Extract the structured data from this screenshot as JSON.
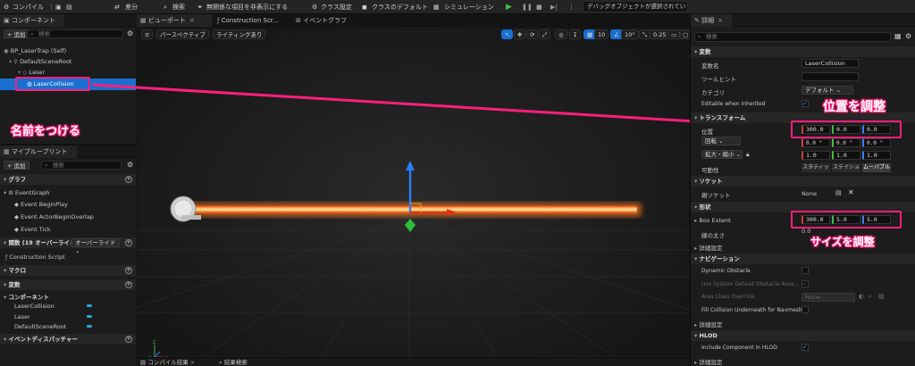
{
  "toolbar": {
    "compile": "コンパイル",
    "diff": "差分",
    "search": "検索",
    "hide_unrelated": "無関係な項目を非表示にする",
    "class_settings": "クラス設定",
    "class_defaults": "クラスのデフォルト",
    "simulation": "シミュレーション",
    "debug_object": "デバッグオブジェクトが選択されていません"
  },
  "components_panel": {
    "title": "コンポーネント",
    "add": "+ 追加",
    "search_placeholder": "検索",
    "tree": [
      "BP_LaserTrap (Self)",
      "DefaultSceneRoot",
      "Laser",
      "LaserCollision"
    ]
  },
  "blueprint_panel": {
    "title": "マイブループリント",
    "add": "+ 追加",
    "search_placeholder": "検索",
    "graph_section": "グラフ",
    "event_graph": "EventGraph",
    "events": [
      "Event BeginPlay",
      "Event ActorBeginOverlap",
      "Event Tick"
    ],
    "functions_section": "関数 (19 オーバーライド可",
    "override_dropdown": "オーバーライド",
    "construction_script": "Construction Script",
    "macro_section": "マクロ",
    "variables_section": "変数",
    "components_subsection": "コンポーネント",
    "component_vars": [
      "LaserCollision",
      "Laser",
      "DefaultSceneRoot"
    ],
    "dispatchers_section": "イベントディスパッチャー"
  },
  "viewport": {
    "tabs": [
      "ビューポート",
      "Construction Scr...",
      "イベントグラフ"
    ],
    "perspective": "パースペクティブ",
    "lighting": "ライティングあり",
    "grid_snap": "10",
    "rot_snap": "10°",
    "scale_snap": "0.25",
    "cam_speed": "1",
    "bottom_tabs": [
      "コンパイル結果",
      "結果検索"
    ],
    "annotation_name": "名前をつける"
  },
  "details": {
    "title": "詳細",
    "search_placeholder": "検索",
    "variable_section": "変数",
    "variable_name_label": "変数名",
    "variable_name": "LaserCollision",
    "tooltip_label": "ツールヒント",
    "category_label": "カテゴリ",
    "category_value": "デフォルト",
    "editable_label": "Editable when Inherited",
    "transform_section": "トランスフォーム",
    "location_label": "位置",
    "location": [
      "300.0",
      "0.0",
      "0.0"
    ],
    "rotation_label": "回転",
    "rotation": [
      "0.0 °",
      "0.0 °",
      "0.0 °"
    ],
    "scale_label": "拡大・縮小",
    "scale": [
      "1.0",
      "1.0",
      "1.0"
    ],
    "mobility_label": "可動性",
    "mobility": [
      "スタティッ",
      "ステイショ",
      "ムーバブル"
    ],
    "socket_section": "ソケット",
    "parent_socket_label": "親ソケット",
    "parent_socket": "None",
    "shape_section": "形状",
    "box_extent_label": "Box Extent",
    "box_extent": [
      "300.0",
      "5.0",
      "5.0"
    ],
    "line_thickness_label": "線の太さ",
    "line_thickness": "0.0",
    "advanced": "詳細設定",
    "navigation_section": "ナビゲーション",
    "dynamic_obstacle": "Dynamic Obstacle",
    "use_system_default": "Use System Default Obstacle Area...",
    "area_class_override": "Area Class Override",
    "area_class_value": "None",
    "fill_collision": "Fill Collision Underneath for Navmesh",
    "hlod_section": "HLOD",
    "include_hlod": "Include Component in HLOD",
    "annotation_location": "位置を調整",
    "annotation_size": "サイズを調整"
  },
  "colors": {
    "accent_pink": "#ff1f7a",
    "selection_blue": "#1a6fd1",
    "laser_orange": "#ff8a1f"
  }
}
